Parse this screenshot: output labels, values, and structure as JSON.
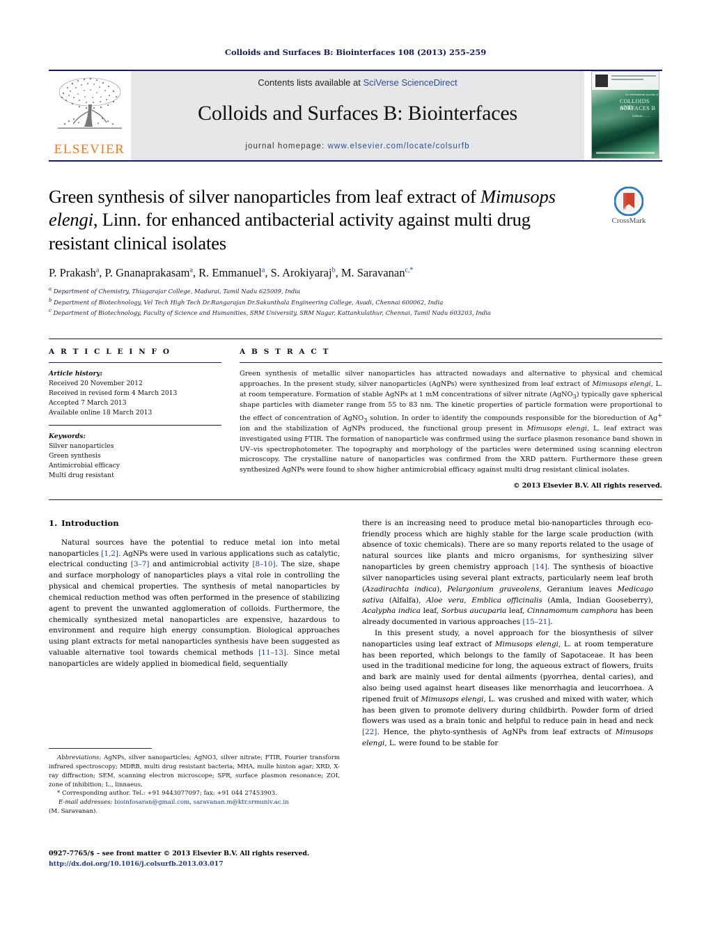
{
  "running_head": "Colloids and Surfaces B: Biointerfaces 108 (2013) 255–259",
  "masthead": {
    "contents_prefix": "Contents lists available at ",
    "contents_link": "SciVerse ScienceDirect",
    "journal_title": "Colloids and Surfaces B: Biointerfaces",
    "homepage_prefix": "journal homepage: ",
    "homepage_url": "www.elsevier.com/locate/colsurfb",
    "publisher_name": "ELSEVIER",
    "cover": {
      "line0": "An International Journal of",
      "line1": "COLLOIDS AND",
      "line2": "SURFACES B",
      "line3": "Editors: ... ..."
    }
  },
  "article": {
    "title_part1": "Green synthesis of silver nanoparticles from leaf extract of ",
    "title_italic1": "Mimusops",
    "title_italic2": "elengi",
    "title_part2": ", Linn. for enhanced antibacterial activity against multi drug",
    "title_part3": "resistant clinical isolates",
    "crossmark_label": "CrossMark",
    "authors": [
      {
        "name": "P. Prakash",
        "sup": "a"
      },
      {
        "name": "P. Gnanaprakasam",
        "sup": "a"
      },
      {
        "name": "R. Emmanuel",
        "sup": "a"
      },
      {
        "name": "S. Arokiyaraj",
        "sup": "b"
      },
      {
        "name": "M. Saravanan",
        "sup": "c,*"
      }
    ],
    "affiliations": [
      {
        "marker": "a",
        "text": "Department of Chemistry, Thiagarajar College, Madurai, Tamil Nadu 625009, India"
      },
      {
        "marker": "b",
        "text": "Department of Biotechnology, Vel Tech High Tech Dr.Rangarajan Dr.Sakunthala Engineering College, Avadi, Chennai 600062, India"
      },
      {
        "marker": "c",
        "text": "Department of Biotechnology, Faculty of Science and Humanities, SRM University, SRM Nagar, Kattankulathur, Chennai, Tamil Nadu 603203, India"
      }
    ]
  },
  "article_info": {
    "heading": "A R T I C L E   I N F O",
    "history_label": "Article history:",
    "history": [
      "Received 20 November 2012",
      "Received in revised form 4 March 2013",
      "Accepted 7 March 2013",
      "Available online 18 March 2013"
    ],
    "keywords_label": "Keywords:",
    "keywords": [
      "Silver nanoparticles",
      "Green synthesis",
      "Antimicrobial efficacy",
      "Multi drug resistant"
    ]
  },
  "abstract": {
    "heading": "A B S T R A C T",
    "p1": "Green synthesis of metallic silver nanoparticles has attracted nowadays and alternative to physical and chemical approaches. In the present study, silver nanoparticles (AgNPs) were synthesized from leaf extract of ",
    "sp1": "Mimusops elengi",
    "p2": ", L. at room temperature. Formation of stable AgNPs at 1 mM concentrations of silver nitrate (AgNO",
    "p2b": ") typically gave spherical shape particles with diameter range from 55 to 83 nm. The kinetic properties of particle formation were proportional to the effect of concentration of AgNO",
    "p2c": " solution. In order to identify the compounds responsible for the bioreduction of Ag",
    "p2d": " ion and the stabilization of AgNPs produced, the functional group present in ",
    "sp2": "Mimusops elengi",
    "p3": ", L. leaf extract was investigated using FTIR. The formation of nanoparticle was confirmed using the surface plasmon resonance band shown in UV–vis spectrophotometer. The topography and morphology of the particles were determined using scanning electron microscopy. The crystalline nature of nanoparticles was confirmed from the XRD pattern. Furthermore these green synthesized AgNPs were found to show higher antimicrobial efficacy against multi drug resistant clinical isolates.",
    "copyright": "© 2013 Elsevier B.V. All rights reserved."
  },
  "introduction": {
    "number": "1.",
    "heading": "Introduction",
    "left_p1_a": "Natural sources have the potential to reduce metal ion into metal nanoparticles ",
    "left_ref1": "[1,2]",
    "left_p1_b": ". AgNPs were used in various applications such as catalytic, electrical conducting ",
    "left_ref2": "[3–7]",
    "left_p1_c": " and antimicrobial activity ",
    "left_ref3": "[8–10]",
    "left_p1_d": ". The size, shape and surface morphology of nanoparticles plays a vital role in controlling the physical and chemical properties. The synthesis of metal nanoparticles by chemical reduction method was often performed in the presence of stabilizing agent to prevent the unwanted agglomeration of colloids. Furthermore, the chemically synthesized metal nanoparticles are expensive, hazardous to environment and require high energy consumption. Biological approaches using plant extracts for metal nanoparticles synthesis have been suggested as valuable alternative tool towards chemical methods ",
    "left_ref4": "[11–13]",
    "left_p1_e": ". Since metal nanoparticles are widely applied in biomedical field, sequentially",
    "right_p1_a": "there is an increasing need to produce metal bio-nanoparticles through eco-friendly process which are highly stable for the large scale production (with absence of toxic chemicals). There are so many reports related to the usage of natural sources like plants and micro organisms, for synthesizing silver nanoparticles by green chemistry approach ",
    "right_ref1": "[14]",
    "right_p1_b": ". The synthesis of bioactive silver nanoparticles using several plant extracts, particularly neem leaf broth (",
    "right_sp1": "Azadirachta indica",
    "right_p1_c": "), ",
    "right_sp2": "Pelargonium graveolens",
    "right_p1_d": ", Geranium leaves ",
    "right_sp3": "Medicago sativa",
    "right_p1_e": " (Alfalfa), ",
    "right_sp4": "Aloe vera",
    "right_p1_f": ", ",
    "right_sp5": "Emblica officinalis",
    "right_p1_g": " (Amla, Indian Gooseberry), ",
    "right_sp6": "Acalypha indica",
    "right_p1_h": " leaf, ",
    "right_sp7": "Sorbus aucuparia",
    "right_p1_i": " leaf, ",
    "right_sp8": "Cinnamomum camphora",
    "right_p1_j": " has been already documented in various approaches ",
    "right_ref2": "[15–21]",
    "right_p1_k": ".",
    "right_p2_a": "In this present study, a novel approach for the biosynthesis of silver nanoparticles using leaf extract of ",
    "right_sp9": "Mimusops elengi",
    "right_p2_b": ", L. at room temperature has been reported, which belongs to the family of Sapotaceae. It has been used in the traditional medicine for long, the aqueous extract of flowers, fruits and bark are mainly used for dental ailments (pyorrhea, dental caries), and also being used against heart diseases like menorrhagia and leucorrhoea. A ripened fruit of ",
    "right_sp10": "Mimusops elengi",
    "right_p2_c": ", L. was crushed and mixed with water, which has been given to promote delivery during childbirth. Powder form of dried flowers was used as a brain tonic and helpful to reduce pain in head and neck ",
    "right_ref3": "[22]",
    "right_p2_d": ". Hence, the phyto-synthesis of AgNPs from leaf extracts of ",
    "right_sp11": "Mimusops elengi",
    "right_p2_e": ", L. were found to be stable for"
  },
  "footnotes": {
    "abbrev_label": "Abbreviations:",
    "abbrev_text": " AgNPs, silver nanoparticles; AgNO3, silver nitrate; FTIR, Fourier transform infrared spectroscopy; MDRB, multi drug resistant bacteria; MHA, mulle hinton agar; XRD, X-ray diffraction; SEM, scanning electron microscope; SPR, surface plasmon resonance; ZOI, zone of inhibition; L., linnaeus.",
    "corresponding_star": "*",
    "corresponding_text": " Corresponding author. Tel.: +91 9443077097; fax: +91 044 27453903.",
    "email_label": "E-mail addresses:",
    "email1": "bioinfosaran@gmail.com",
    "email_sep": ", ",
    "email2": "saravanan.m@ktr.srmuniv.ac.in",
    "email_owner": "(M. Saravanan)."
  },
  "page_footer": {
    "issn_line": "0927-7765/$ – see front matter © 2013 Elsevier B.V. All rights reserved.",
    "doi_line": "http://dx.doi.org/10.1016/j.colsurfb.2013.03.017"
  }
}
